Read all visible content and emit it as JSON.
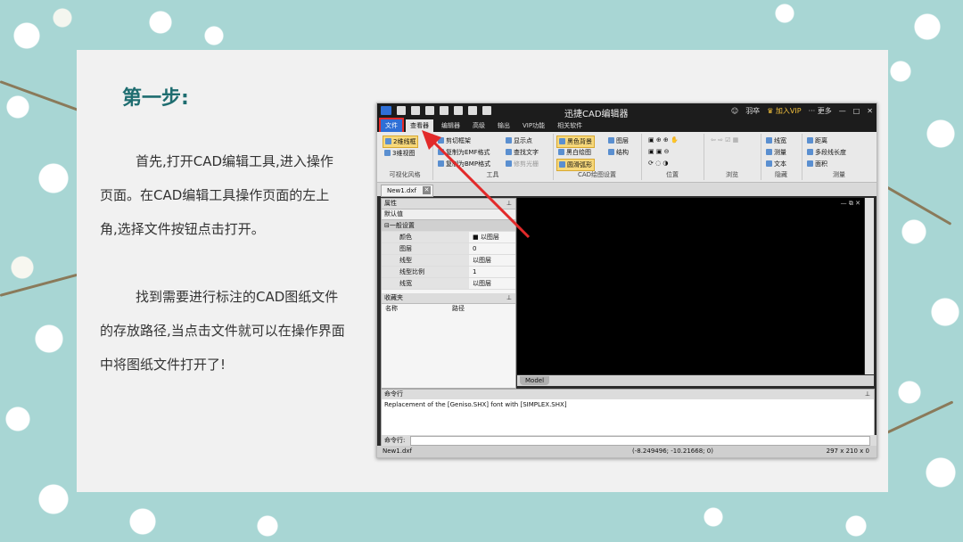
{
  "slide": {
    "heading": "第一步:",
    "paragraph1": "首先,打开CAD编辑工具,进入操作页面。在CAD编辑工具操作页面的左上角,选择文件按钮点击打开。",
    "paragraph2": "找到需要进行标注的CAD图纸文件的存放路径,当点击文件就可以在操作界面中将图纸文件打开了!"
  },
  "app": {
    "title": "迅捷CAD编辑器",
    "user": "羽卒",
    "vip": "加入VIP",
    "more": "更多",
    "menus": [
      "文件",
      "查看器",
      "编辑器",
      "高级",
      "输出",
      "VIP功能",
      "相关软件"
    ],
    "groups": {
      "visual_style": "可视化风格",
      "tools": "工具",
      "cad_settings": "CAD绘图设置",
      "position": "位置",
      "browse": "浏览",
      "hide": "隐藏",
      "measure": "测量"
    },
    "buttons": {
      "wireframe2d": "2维线框",
      "view3d": "3维视图",
      "clip_frame": "剪切框架",
      "copy_emf": "复制为EMF格式",
      "copy_bmp": "复制为BMP格式",
      "show_points": "显示点",
      "find_text": "查找文字",
      "trim_light": "修剪光栅",
      "black_bg": "黑色背景",
      "bw_draw": "黑白绘图",
      "smooth_arc": "圆滑弧形",
      "layers": "图层",
      "structure": "结构",
      "line_width": "线宽",
      "measure_btn": "测量",
      "text_btn": "文本",
      "distance": "距离",
      "polyline_len": "多段线长度",
      "area": "面积"
    },
    "doc_tab": "New1.dxf",
    "properties": {
      "header": "属性",
      "default": "默认值",
      "section": "一般设置",
      "rows": [
        {
          "k": "颜色",
          "v": "■ 以图层"
        },
        {
          "k": "图层",
          "v": "0"
        },
        {
          "k": "线型",
          "v": "以图层"
        },
        {
          "k": "线型比例",
          "v": "1"
        },
        {
          "k": "线宽",
          "v": "以图层"
        }
      ]
    },
    "favorites": {
      "header": "收藏夹",
      "col_name": "名称",
      "col_path": "路径"
    },
    "model_tab": "Model",
    "command": {
      "header": "命令行",
      "text": "Replacement of the [Geniso.SHX] font with [SIMPLEX.SHX]",
      "input_label": "命令行:"
    },
    "status": {
      "file": "New1.dxf",
      "coords": "(-8.249496; -10.21668; 0)",
      "size": "297 x 210 x 0"
    }
  }
}
